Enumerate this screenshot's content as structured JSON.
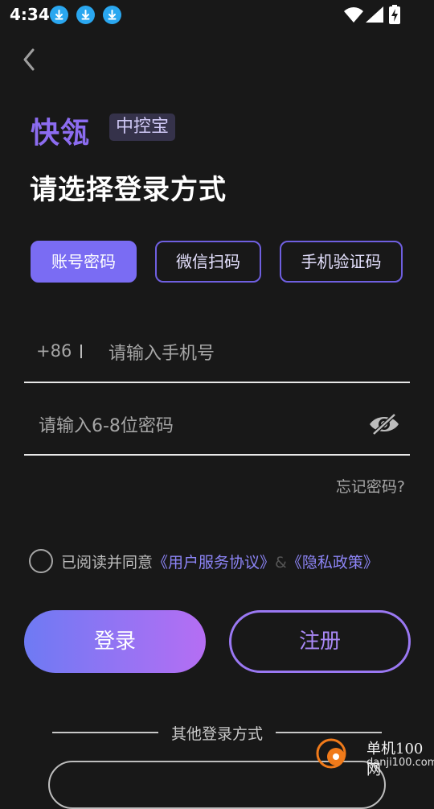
{
  "status_bar": {
    "time": "4:34",
    "icons": [
      "download-icon",
      "download-icon",
      "download-icon",
      "wifi-icon",
      "signal-icon",
      "battery-charging-icon"
    ]
  },
  "header": {
    "back_icon": "chevron-left-icon"
  },
  "brand": {
    "name": "快瓴",
    "tag": "中控宝"
  },
  "title": "请选择登录方式",
  "tabs": [
    {
      "label": "账号密码",
      "active": true
    },
    {
      "label": "微信扫码",
      "active": false
    },
    {
      "label": "手机验证码",
      "active": false
    }
  ],
  "phone": {
    "country_code": "+86",
    "placeholder": "请输入手机号",
    "value": ""
  },
  "password": {
    "placeholder": "请输入6-8位密码",
    "value": "",
    "toggle_icon": "eye-hidden-icon"
  },
  "forgot_password": "忘记密码?",
  "agreement": {
    "prefix": "已阅读并同意",
    "user_agreement": "《用户服务协议》",
    "separator": "&",
    "privacy_policy": "《隐私政策》",
    "checked": false
  },
  "buttons": {
    "login": "登录",
    "register": "注册"
  },
  "other_login": {
    "label": "其他登录方式"
  },
  "watermark": {
    "name": "单机100网",
    "url": "danji100.com"
  },
  "colors": {
    "background": "#181818",
    "accent": "#7a6cf3",
    "brand": "#8c6cf0",
    "link": "#8c84f5",
    "gradient_start": "#6e7af3",
    "gradient_end": "#b56ef3"
  }
}
